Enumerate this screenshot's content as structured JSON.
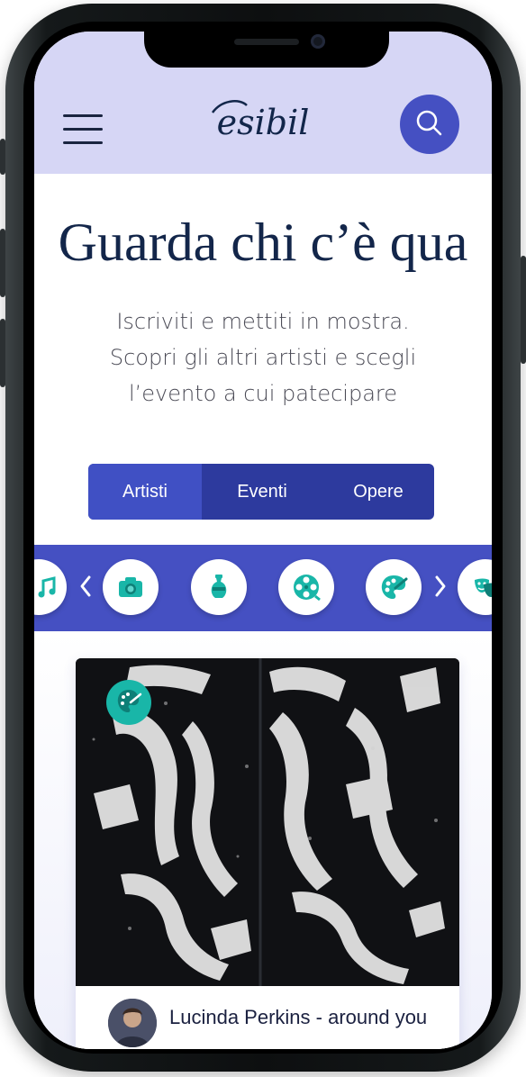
{
  "header": {
    "logo_text": "esibil",
    "menu_icon": "hamburger-menu-icon",
    "search_icon": "search-icon",
    "accent_color": "#4550c2",
    "background_color": "#d6d6f5"
  },
  "hero": {
    "title": "Guarda chi c’è qua",
    "subtitle_lines": [
      "Iscriviti e mettiti in mostra.",
      "Scopri gli altri artisti e scegli",
      "l’evento a cui patecipare"
    ]
  },
  "tabs": [
    {
      "label": "Artisti",
      "active": true
    },
    {
      "label": "Eventi",
      "active": false
    },
    {
      "label": "Opere",
      "active": false
    }
  ],
  "categories": {
    "items": [
      {
        "name": "music",
        "icon": "music-note-icon"
      },
      {
        "name": "photography",
        "icon": "camera-icon"
      },
      {
        "name": "sculpture",
        "icon": "vase-icon"
      },
      {
        "name": "cinema",
        "icon": "film-reel-icon"
      },
      {
        "name": "painting",
        "icon": "palette-icon"
      },
      {
        "name": "theatre",
        "icon": "theatre-masks-icon"
      }
    ],
    "prev_icon": "chevron-left-icon",
    "next_icon": "chevron-right-icon",
    "icon_color": "#19b6a8"
  },
  "card": {
    "badge_icon": "palette-icon",
    "author": "Lucinda Perkins - around you"
  }
}
